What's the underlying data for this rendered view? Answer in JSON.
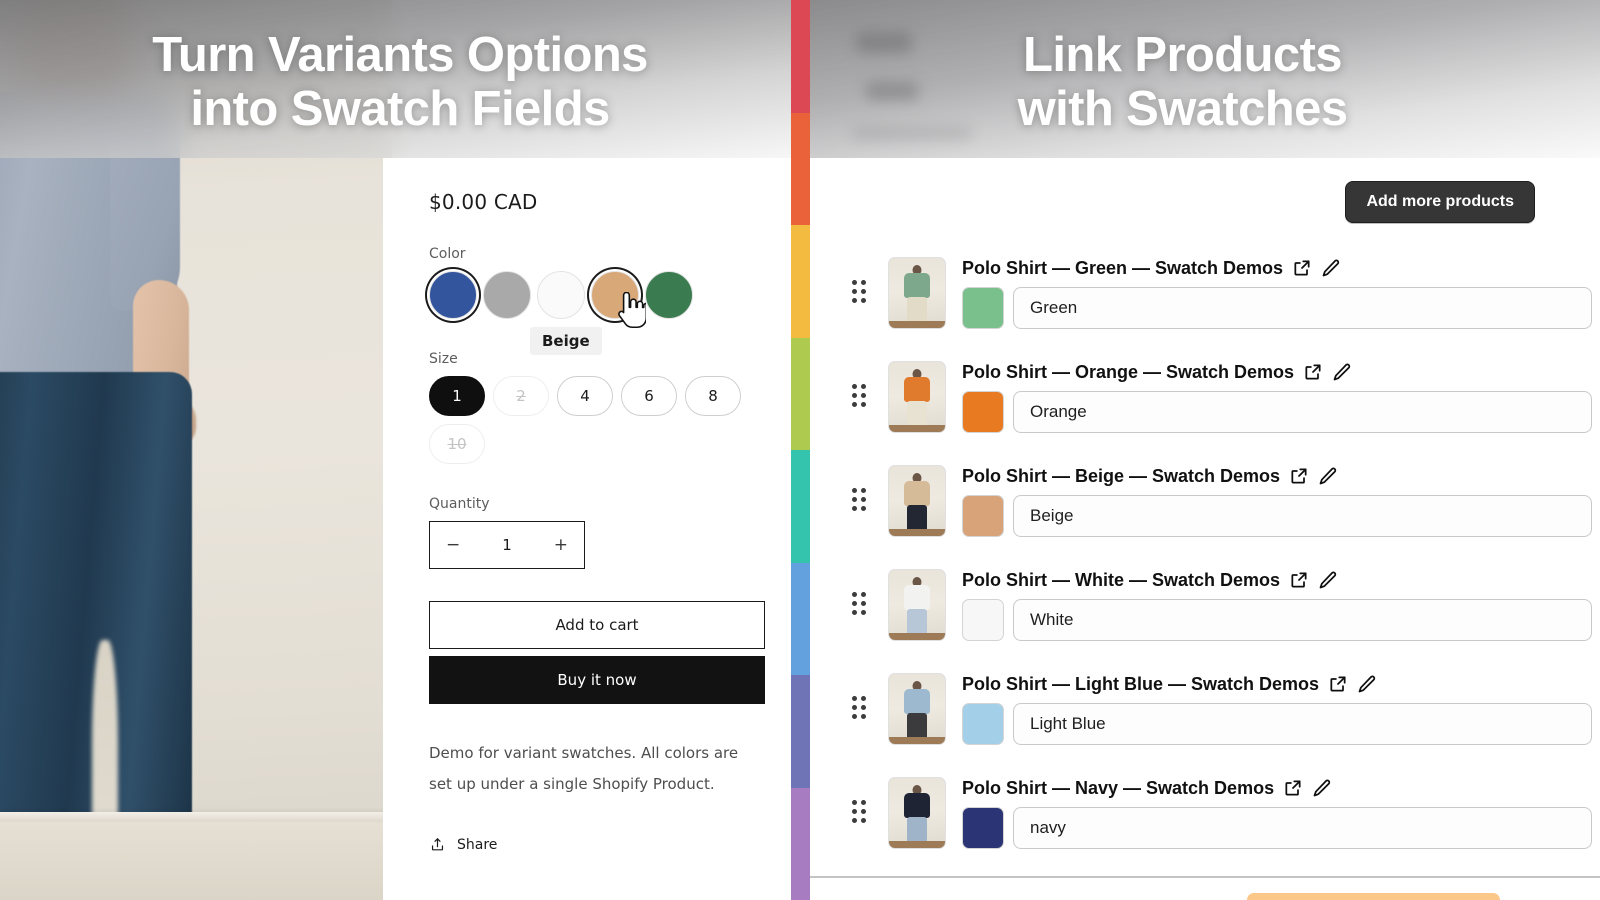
{
  "hero": {
    "left_headline": "Turn Variants  Options\ninto Swatch Fields",
    "right_headline": "Link Products\nwith Swatches"
  },
  "storefront": {
    "price": "$0.00 CAD",
    "color_label": "Color",
    "color_swatches": [
      {
        "name": "Blue",
        "hex": "#33559e",
        "state": "selected"
      },
      {
        "name": "Grey",
        "hex": "#a9a9a9",
        "state": "default"
      },
      {
        "name": "White",
        "hex": "#fafafa",
        "state": "default"
      },
      {
        "name": "Beige",
        "hex": "#d9a878",
        "state": "hovered"
      },
      {
        "name": "Green",
        "hex": "#3a7c4f",
        "state": "default"
      }
    ],
    "hover_tooltip": "Beige",
    "size_label": "Size",
    "sizes": [
      {
        "value": "1",
        "state": "selected"
      },
      {
        "value": "2",
        "state": "unavailable"
      },
      {
        "value": "4",
        "state": "default"
      },
      {
        "value": "6",
        "state": "default"
      },
      {
        "value": "8",
        "state": "default"
      },
      {
        "value": "10",
        "state": "unavailable"
      }
    ],
    "quantity_label": "Quantity",
    "quantity_value": "1",
    "quantity_decrease": "−",
    "quantity_increase": "+",
    "add_to_cart_label": "Add to cart",
    "buy_now_label": "Buy it now",
    "description": "Demo for variant swatches. All colors are set up under a single Shopify Product.",
    "share_label": "Share"
  },
  "divider": {
    "colors": [
      "#dc4853",
      "#e96239",
      "#f4bb41",
      "#aecb4f",
      "#34c3ad",
      "#62a0de",
      "#6f74b6",
      "#a87cc0"
    ]
  },
  "admin": {
    "add_more_products_label": "Add more products",
    "rows": [
      {
        "title": "Polo Shirt — Green — Swatch Demos",
        "swatch_hex": "#79c08c",
        "field_value": "Green",
        "thumb": {
          "shirt": "#7ea88c",
          "pants": "#e2dbc8"
        }
      },
      {
        "title": "Polo Shirt — Orange — Swatch Demos",
        "swatch_hex": "#e87b22",
        "field_value": "Orange",
        "thumb": {
          "shirt": "#e07a2d",
          "pants": "#e8e2d2"
        }
      },
      {
        "title": "Polo Shirt — Beige — Swatch Demos",
        "swatch_hex": "#d8a379",
        "field_value": "Beige",
        "thumb": {
          "shirt": "#d6bb99",
          "pants": "#232733"
        }
      },
      {
        "title": "Polo Shirt — White — Swatch Demos",
        "swatch_hex": "#f7f7f7",
        "field_value": "White",
        "thumb": {
          "shirt": "#f2f2f0",
          "pants": "#b7c7d8"
        }
      },
      {
        "title": "Polo Shirt — Light Blue — Swatch Demos",
        "swatch_hex": "#a3cfe8",
        "field_value": "Light Blue",
        "thumb": {
          "shirt": "#9cb9cf",
          "pants": "#3b3b3d"
        }
      },
      {
        "title": "Polo Shirt — Navy — Swatch Demos",
        "swatch_hex": "#2b3474",
        "field_value": "navy",
        "thumb": {
          "shirt": "#1f2434",
          "pants": "#9fb4c8"
        }
      }
    ],
    "row_icons": {
      "open": "external-link-icon",
      "edit": "pencil-icon"
    }
  }
}
